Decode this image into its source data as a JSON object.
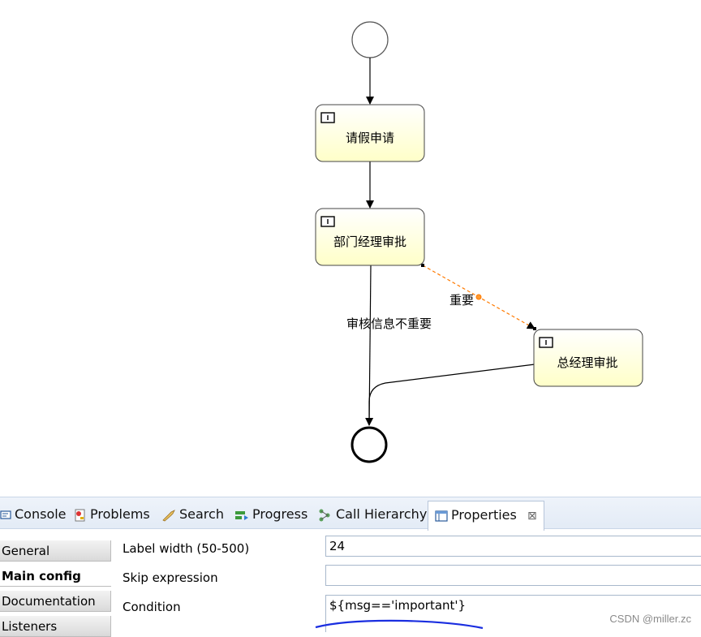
{
  "diagram": {
    "tasks": [
      {
        "id": "apply",
        "label": "请假申请"
      },
      {
        "id": "dept",
        "label": "部门经理审批"
      },
      {
        "id": "gm",
        "label": "总经理审批"
      }
    ],
    "flows": {
      "important_label": "重要",
      "not_important_label": "审核信息不重要"
    },
    "colors": {
      "task_fill_top": "#ffffff",
      "task_fill_bottom": "#ffffc8",
      "selected_flow": "#ff7a00"
    }
  },
  "tabs": [
    {
      "label": "Console",
      "icon": "console-icon"
    },
    {
      "label": "Problems",
      "icon": "problems-icon"
    },
    {
      "label": "Search",
      "icon": "search-icon"
    },
    {
      "label": "Progress",
      "icon": "progress-icon"
    },
    {
      "label": "Call Hierarchy",
      "icon": "call-hierarchy-icon"
    },
    {
      "label": "Properties",
      "icon": "properties-icon",
      "active": true
    }
  ],
  "sidebar": {
    "items": [
      {
        "label": "General"
      },
      {
        "label": "Main config",
        "selected": true
      },
      {
        "label": "Documentation"
      },
      {
        "label": "Listeners"
      }
    ]
  },
  "properties": {
    "label_width": {
      "label": "Label width (50-500)",
      "value": "24"
    },
    "skip_expression": {
      "label": "Skip expression",
      "value": ""
    },
    "condition": {
      "label": "Condition",
      "value": "${msg=='important'}"
    }
  },
  "watermark": "CSDN @miller.zc"
}
